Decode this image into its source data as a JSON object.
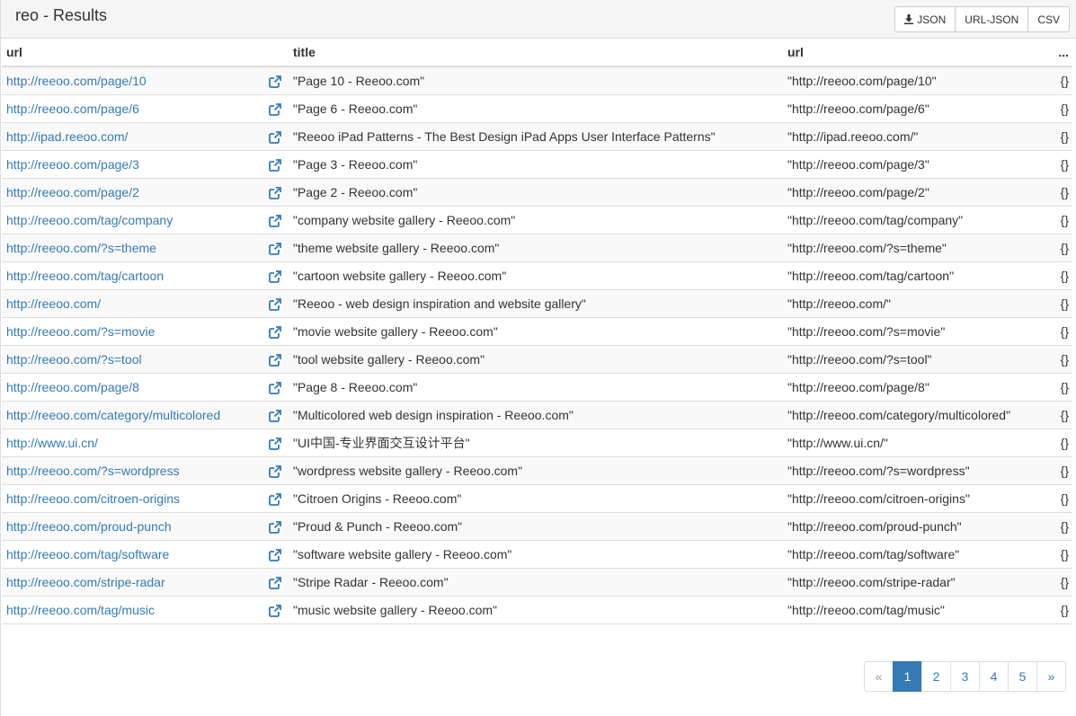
{
  "header": {
    "title": "reo - Results",
    "export_buttons": [
      "JSON",
      "URL-JSON",
      "CSV"
    ]
  },
  "table": {
    "columns": [
      "url",
      "title",
      "url",
      "..."
    ],
    "rows": [
      {
        "url": "http://reeoo.com/page/10",
        "title": "\"Page 10 - Reeoo.com\"",
        "url_value": "\"http://reeoo.com/page/10\"",
        "obj": "{}"
      },
      {
        "url": "http://reeoo.com/page/6",
        "title": "\"Page 6 - Reeoo.com\"",
        "url_value": "\"http://reeoo.com/page/6\"",
        "obj": "{}"
      },
      {
        "url": "http://ipad.reeoo.com/",
        "title": "\"Reeoo iPad Patterns - The Best Design iPad Apps User Interface Patterns\"",
        "url_value": "\"http://ipad.reeoo.com/\"",
        "obj": "{}"
      },
      {
        "url": "http://reeoo.com/page/3",
        "title": "\"Page 3 - Reeoo.com\"",
        "url_value": "\"http://reeoo.com/page/3\"",
        "obj": "{}"
      },
      {
        "url": "http://reeoo.com/page/2",
        "title": "\"Page 2 - Reeoo.com\"",
        "url_value": "\"http://reeoo.com/page/2\"",
        "obj": "{}"
      },
      {
        "url": "http://reeoo.com/tag/company",
        "title": "\"company website gallery - Reeoo.com\"",
        "url_value": "\"http://reeoo.com/tag/company\"",
        "obj": "{}"
      },
      {
        "url": "http://reeoo.com/?s=theme",
        "title": "\"theme website gallery - Reeoo.com\"",
        "url_value": "\"http://reeoo.com/?s=theme\"",
        "obj": "{}"
      },
      {
        "url": "http://reeoo.com/tag/cartoon",
        "title": "\"cartoon website gallery - Reeoo.com\"",
        "url_value": "\"http://reeoo.com/tag/cartoon\"",
        "obj": "{}"
      },
      {
        "url": "http://reeoo.com/",
        "title": "\"Reeoo - web design inspiration and website gallery\"",
        "url_value": "\"http://reeoo.com/\"",
        "obj": "{}"
      },
      {
        "url": "http://reeoo.com/?s=movie",
        "title": "\"movie website gallery - Reeoo.com\"",
        "url_value": "\"http://reeoo.com/?s=movie\"",
        "obj": "{}"
      },
      {
        "url": "http://reeoo.com/?s=tool",
        "title": "\"tool website gallery - Reeoo.com\"",
        "url_value": "\"http://reeoo.com/?s=tool\"",
        "obj": "{}"
      },
      {
        "url": "http://reeoo.com/page/8",
        "title": "\"Page 8 - Reeoo.com\"",
        "url_value": "\"http://reeoo.com/page/8\"",
        "obj": "{}"
      },
      {
        "url": "http://reeoo.com/category/multicolored",
        "title": "\"Multicolored web design inspiration - Reeoo.com\"",
        "url_value": "\"http://reeoo.com/category/multicolored\"",
        "obj": "{}"
      },
      {
        "url": "http://www.ui.cn/",
        "title": "\"UI中国-专业界面交互设计平台\"",
        "url_value": "\"http://www.ui.cn/\"",
        "obj": "{}"
      },
      {
        "url": "http://reeoo.com/?s=wordpress",
        "title": "\"wordpress website gallery - Reeoo.com\"",
        "url_value": "\"http://reeoo.com/?s=wordpress\"",
        "obj": "{}"
      },
      {
        "url": "http://reeoo.com/citroen-origins",
        "title": "\"Citroen Origins - Reeoo.com\"",
        "url_value": "\"http://reeoo.com/citroen-origins\"",
        "obj": "{}"
      },
      {
        "url": "http://reeoo.com/proud-punch",
        "title": "\"Proud & Punch - Reeoo.com\"",
        "url_value": "\"http://reeoo.com/proud-punch\"",
        "obj": "{}"
      },
      {
        "url": "http://reeoo.com/tag/software",
        "title": "\"software website gallery - Reeoo.com\"",
        "url_value": "\"http://reeoo.com/tag/software\"",
        "obj": "{}"
      },
      {
        "url": "http://reeoo.com/stripe-radar",
        "title": "\"Stripe Radar - Reeoo.com\"",
        "url_value": "\"http://reeoo.com/stripe-radar\"",
        "obj": "{}"
      },
      {
        "url": "http://reeoo.com/tag/music",
        "title": "\"music website gallery - Reeoo.com\"",
        "url_value": "\"http://reeoo.com/tag/music\"",
        "obj": "{}"
      }
    ]
  },
  "pagination": {
    "prev": "«",
    "pages": [
      "1",
      "2",
      "3",
      "4",
      "5"
    ],
    "active_page": "1",
    "next": "»"
  },
  "colors": {
    "link": "#337ab7",
    "header_bg": "#f5f5f5",
    "stripe": "#f9f9f9",
    "border": "#dddddd"
  },
  "icons": [
    "download-icon",
    "external-link-icon"
  ]
}
